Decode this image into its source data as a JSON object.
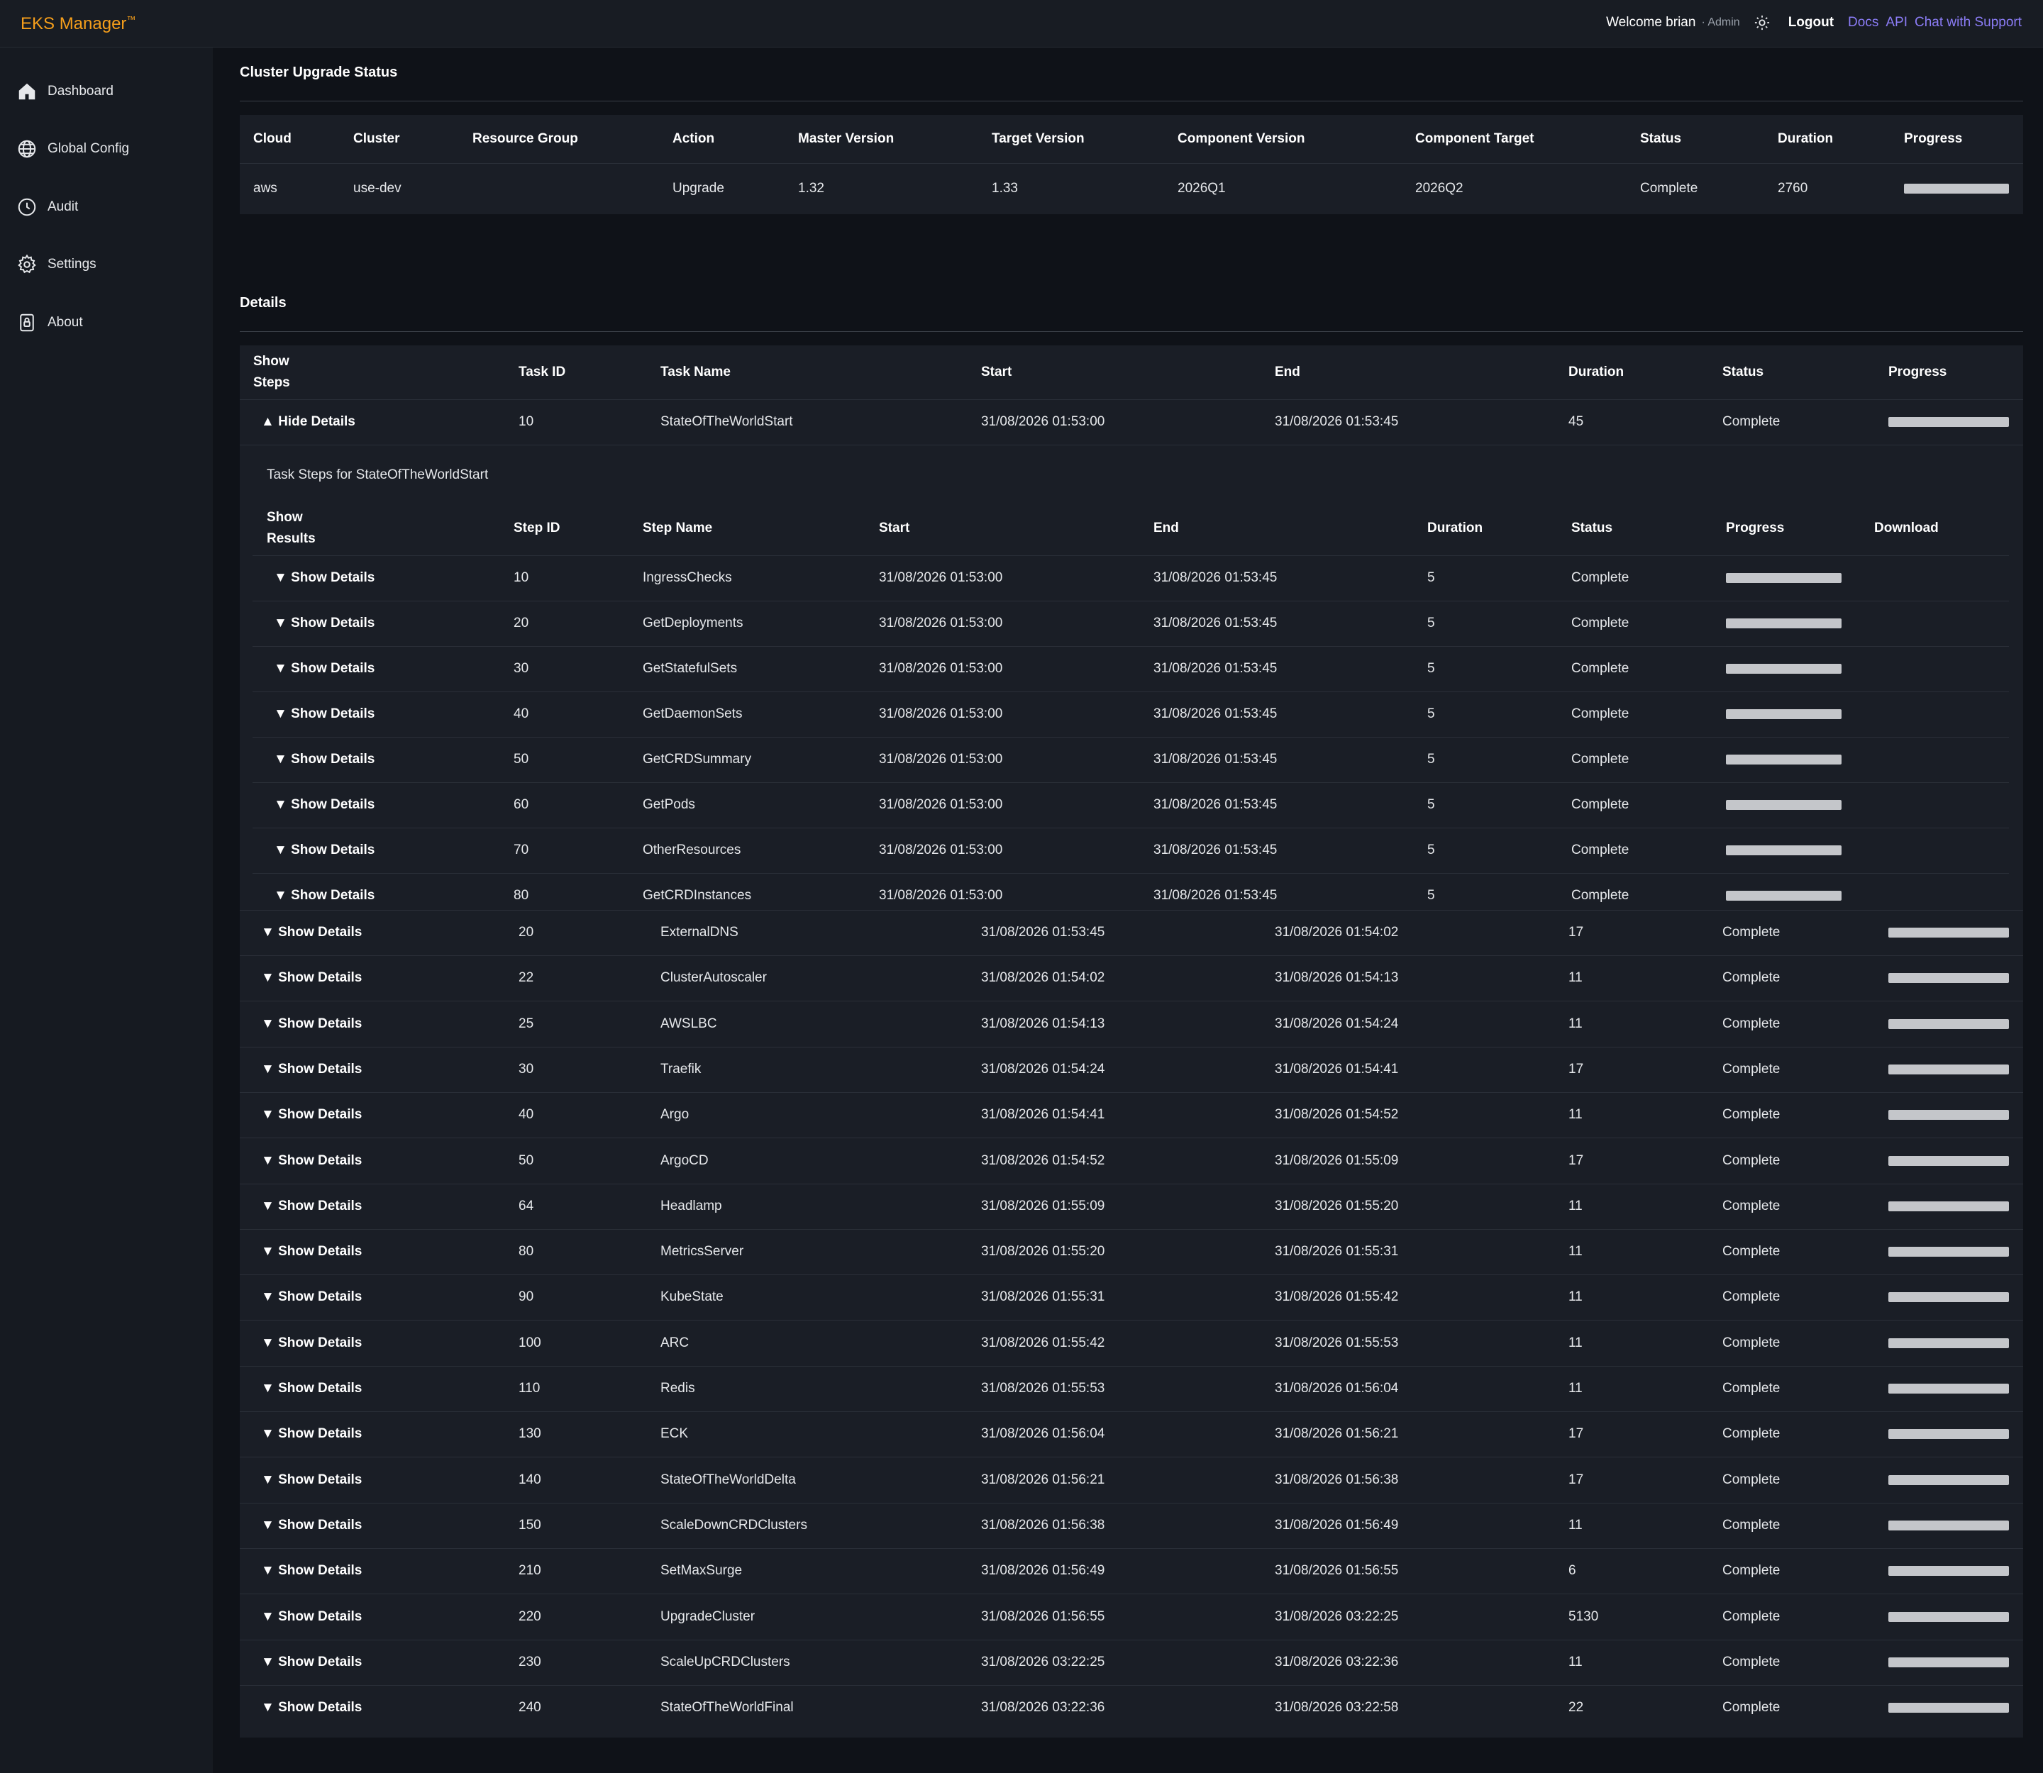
{
  "app": {
    "brand": "EKS Manager",
    "brand_mark": "™"
  },
  "topbar": {
    "welcome": "Welcome brian",
    "role": "· Admin",
    "theme_icon": "sun-icon",
    "logout": "Logout",
    "links": [
      "Docs",
      "API",
      "Chat with Support"
    ]
  },
  "sidebar": {
    "items": [
      {
        "label": "Dashboard",
        "icon": "home-icon"
      },
      {
        "label": "Global Config",
        "icon": "globe-icon"
      },
      {
        "label": "Audit",
        "icon": "clock-icon"
      },
      {
        "label": "Settings",
        "icon": "gear-icon"
      },
      {
        "label": "About",
        "icon": "lock-icon"
      }
    ]
  },
  "upgrade": {
    "title": "Cluster Upgrade Status",
    "headers": [
      "Cloud",
      "Cluster",
      "Resource Group",
      "Action",
      "Master Version",
      "Target Version",
      "Component Version",
      "Component Target",
      "Status",
      "Duration",
      "Progress"
    ],
    "row": {
      "cloud": "aws",
      "cluster": "use-dev",
      "resource_group": "",
      "action": "Upgrade",
      "master_version": "1.32",
      "target_version": "1.33",
      "component_version": "2026Q1",
      "component_target": "2026Q2",
      "status": "Complete",
      "duration": "2760",
      "progress": 100
    }
  },
  "details": {
    "title": "Details",
    "headers": {
      "show_steps": "Show Steps",
      "task_id": "Task ID",
      "task_name": "Task Name",
      "start": "Start",
      "end": "End",
      "duration": "Duration",
      "status": "Status",
      "progress": "Progress"
    },
    "expanded_task": {
      "toggle": "▲ Hide Details",
      "id": "10",
      "name": "StateOfTheWorldStart",
      "start": "31/08/2026 01:53:00",
      "end": "31/08/2026 01:53:45",
      "duration": "45",
      "status": "Complete",
      "progress": 100,
      "steps_title": "Task Steps for StateOfTheWorldStart",
      "step_headers": {
        "show_results": "Show Results",
        "step_id": "Step ID",
        "step_name": "Step Name",
        "start": "Start",
        "end": "End",
        "duration": "Duration",
        "status": "Status",
        "progress": "Progress",
        "download": "Download"
      },
      "steps": [
        {
          "toggle": "▼ Show Details",
          "id": "10",
          "name": "IngressChecks",
          "start": "31/08/2026 01:53:00",
          "end": "31/08/2026 01:53:45",
          "duration": "5",
          "status": "Complete",
          "progress": 100
        },
        {
          "toggle": "▼ Show Details",
          "id": "20",
          "name": "GetDeployments",
          "start": "31/08/2026 01:53:00",
          "end": "31/08/2026 01:53:45",
          "duration": "5",
          "status": "Complete",
          "progress": 100
        },
        {
          "toggle": "▼ Show Details",
          "id": "30",
          "name": "GetStatefulSets",
          "start": "31/08/2026 01:53:00",
          "end": "31/08/2026 01:53:45",
          "duration": "5",
          "status": "Complete",
          "progress": 100
        },
        {
          "toggle": "▼ Show Details",
          "id": "40",
          "name": "GetDaemonSets",
          "start": "31/08/2026 01:53:00",
          "end": "31/08/2026 01:53:45",
          "duration": "5",
          "status": "Complete",
          "progress": 100
        },
        {
          "toggle": "▼ Show Details",
          "id": "50",
          "name": "GetCRDSummary",
          "start": "31/08/2026 01:53:00",
          "end": "31/08/2026 01:53:45",
          "duration": "5",
          "status": "Complete",
          "progress": 100
        },
        {
          "toggle": "▼ Show Details",
          "id": "60",
          "name": "GetPods",
          "start": "31/08/2026 01:53:00",
          "end": "31/08/2026 01:53:45",
          "duration": "5",
          "status": "Complete",
          "progress": 100
        },
        {
          "toggle": "▼ Show Details",
          "id": "70",
          "name": "OtherResources",
          "start": "31/08/2026 01:53:00",
          "end": "31/08/2026 01:53:45",
          "duration": "5",
          "status": "Complete",
          "progress": 100
        },
        {
          "toggle": "▼ Show Details",
          "id": "80",
          "name": "GetCRDInstances",
          "start": "31/08/2026 01:53:00",
          "end": "31/08/2026 01:53:45",
          "duration": "5",
          "status": "Complete",
          "progress": 100
        }
      ]
    },
    "tasks": [
      {
        "toggle": "▼ Show Details",
        "id": "20",
        "name": "ExternalDNS",
        "start": "31/08/2026 01:53:45",
        "end": "31/08/2026 01:54:02",
        "duration": "17",
        "status": "Complete",
        "progress": 100
      },
      {
        "toggle": "▼ Show Details",
        "id": "22",
        "name": "ClusterAutoscaler",
        "start": "31/08/2026 01:54:02",
        "end": "31/08/2026 01:54:13",
        "duration": "11",
        "status": "Complete",
        "progress": 100
      },
      {
        "toggle": "▼ Show Details",
        "id": "25",
        "name": "AWSLBC",
        "start": "31/08/2026 01:54:13",
        "end": "31/08/2026 01:54:24",
        "duration": "11",
        "status": "Complete",
        "progress": 100
      },
      {
        "toggle": "▼ Show Details",
        "id": "30",
        "name": "Traefik",
        "start": "31/08/2026 01:54:24",
        "end": "31/08/2026 01:54:41",
        "duration": "17",
        "status": "Complete",
        "progress": 100
      },
      {
        "toggle": "▼ Show Details",
        "id": "40",
        "name": "Argo",
        "start": "31/08/2026 01:54:41",
        "end": "31/08/2026 01:54:52",
        "duration": "11",
        "status": "Complete",
        "progress": 100
      },
      {
        "toggle": "▼ Show Details",
        "id": "50",
        "name": "ArgoCD",
        "start": "31/08/2026 01:54:52",
        "end": "31/08/2026 01:55:09",
        "duration": "17",
        "status": "Complete",
        "progress": 100
      },
      {
        "toggle": "▼ Show Details",
        "id": "64",
        "name": "Headlamp",
        "start": "31/08/2026 01:55:09",
        "end": "31/08/2026 01:55:20",
        "duration": "11",
        "status": "Complete",
        "progress": 100
      },
      {
        "toggle": "▼ Show Details",
        "id": "80",
        "name": "MetricsServer",
        "start": "31/08/2026 01:55:20",
        "end": "31/08/2026 01:55:31",
        "duration": "11",
        "status": "Complete",
        "progress": 100
      },
      {
        "toggle": "▼ Show Details",
        "id": "90",
        "name": "KubeState",
        "start": "31/08/2026 01:55:31",
        "end": "31/08/2026 01:55:42",
        "duration": "11",
        "status": "Complete",
        "progress": 100
      },
      {
        "toggle": "▼ Show Details",
        "id": "100",
        "name": "ARC",
        "start": "31/08/2026 01:55:42",
        "end": "31/08/2026 01:55:53",
        "duration": "11",
        "status": "Complete",
        "progress": 100
      },
      {
        "toggle": "▼ Show Details",
        "id": "110",
        "name": "Redis",
        "start": "31/08/2026 01:55:53",
        "end": "31/08/2026 01:56:04",
        "duration": "11",
        "status": "Complete",
        "progress": 100
      },
      {
        "toggle": "▼ Show Details",
        "id": "130",
        "name": "ECK",
        "start": "31/08/2026 01:56:04",
        "end": "31/08/2026 01:56:21",
        "duration": "17",
        "status": "Complete",
        "progress": 100
      },
      {
        "toggle": "▼ Show Details",
        "id": "140",
        "name": "StateOfTheWorldDelta",
        "start": "31/08/2026 01:56:21",
        "end": "31/08/2026 01:56:38",
        "duration": "17",
        "status": "Complete",
        "progress": 100
      },
      {
        "toggle": "▼ Show Details",
        "id": "150",
        "name": "ScaleDownCRDClusters",
        "start": "31/08/2026 01:56:38",
        "end": "31/08/2026 01:56:49",
        "duration": "11",
        "status": "Complete",
        "progress": 100
      },
      {
        "toggle": "▼ Show Details",
        "id": "210",
        "name": "SetMaxSurge",
        "start": "31/08/2026 01:56:49",
        "end": "31/08/2026 01:56:55",
        "duration": "6",
        "status": "Complete",
        "progress": 100
      },
      {
        "toggle": "▼ Show Details",
        "id": "220",
        "name": "UpgradeCluster",
        "start": "31/08/2026 01:56:55",
        "end": "31/08/2026 03:22:25",
        "duration": "5130",
        "status": "Complete",
        "progress": 100
      },
      {
        "toggle": "▼ Show Details",
        "id": "230",
        "name": "ScaleUpCRDClusters",
        "start": "31/08/2026 03:22:25",
        "end": "31/08/2026 03:22:36",
        "duration": "11",
        "status": "Complete",
        "progress": 100
      },
      {
        "toggle": "▼ Show Details",
        "id": "240",
        "name": "StateOfTheWorldFinal",
        "start": "31/08/2026 03:22:36",
        "end": "31/08/2026 03:22:58",
        "duration": "22",
        "status": "Complete",
        "progress": 100
      }
    ]
  },
  "colors": {
    "brand": "#f59e1b",
    "link": "#8b7cf6",
    "background": "#0f1218",
    "panel": "#1a1e26",
    "progress": "#c4c6ca"
  }
}
